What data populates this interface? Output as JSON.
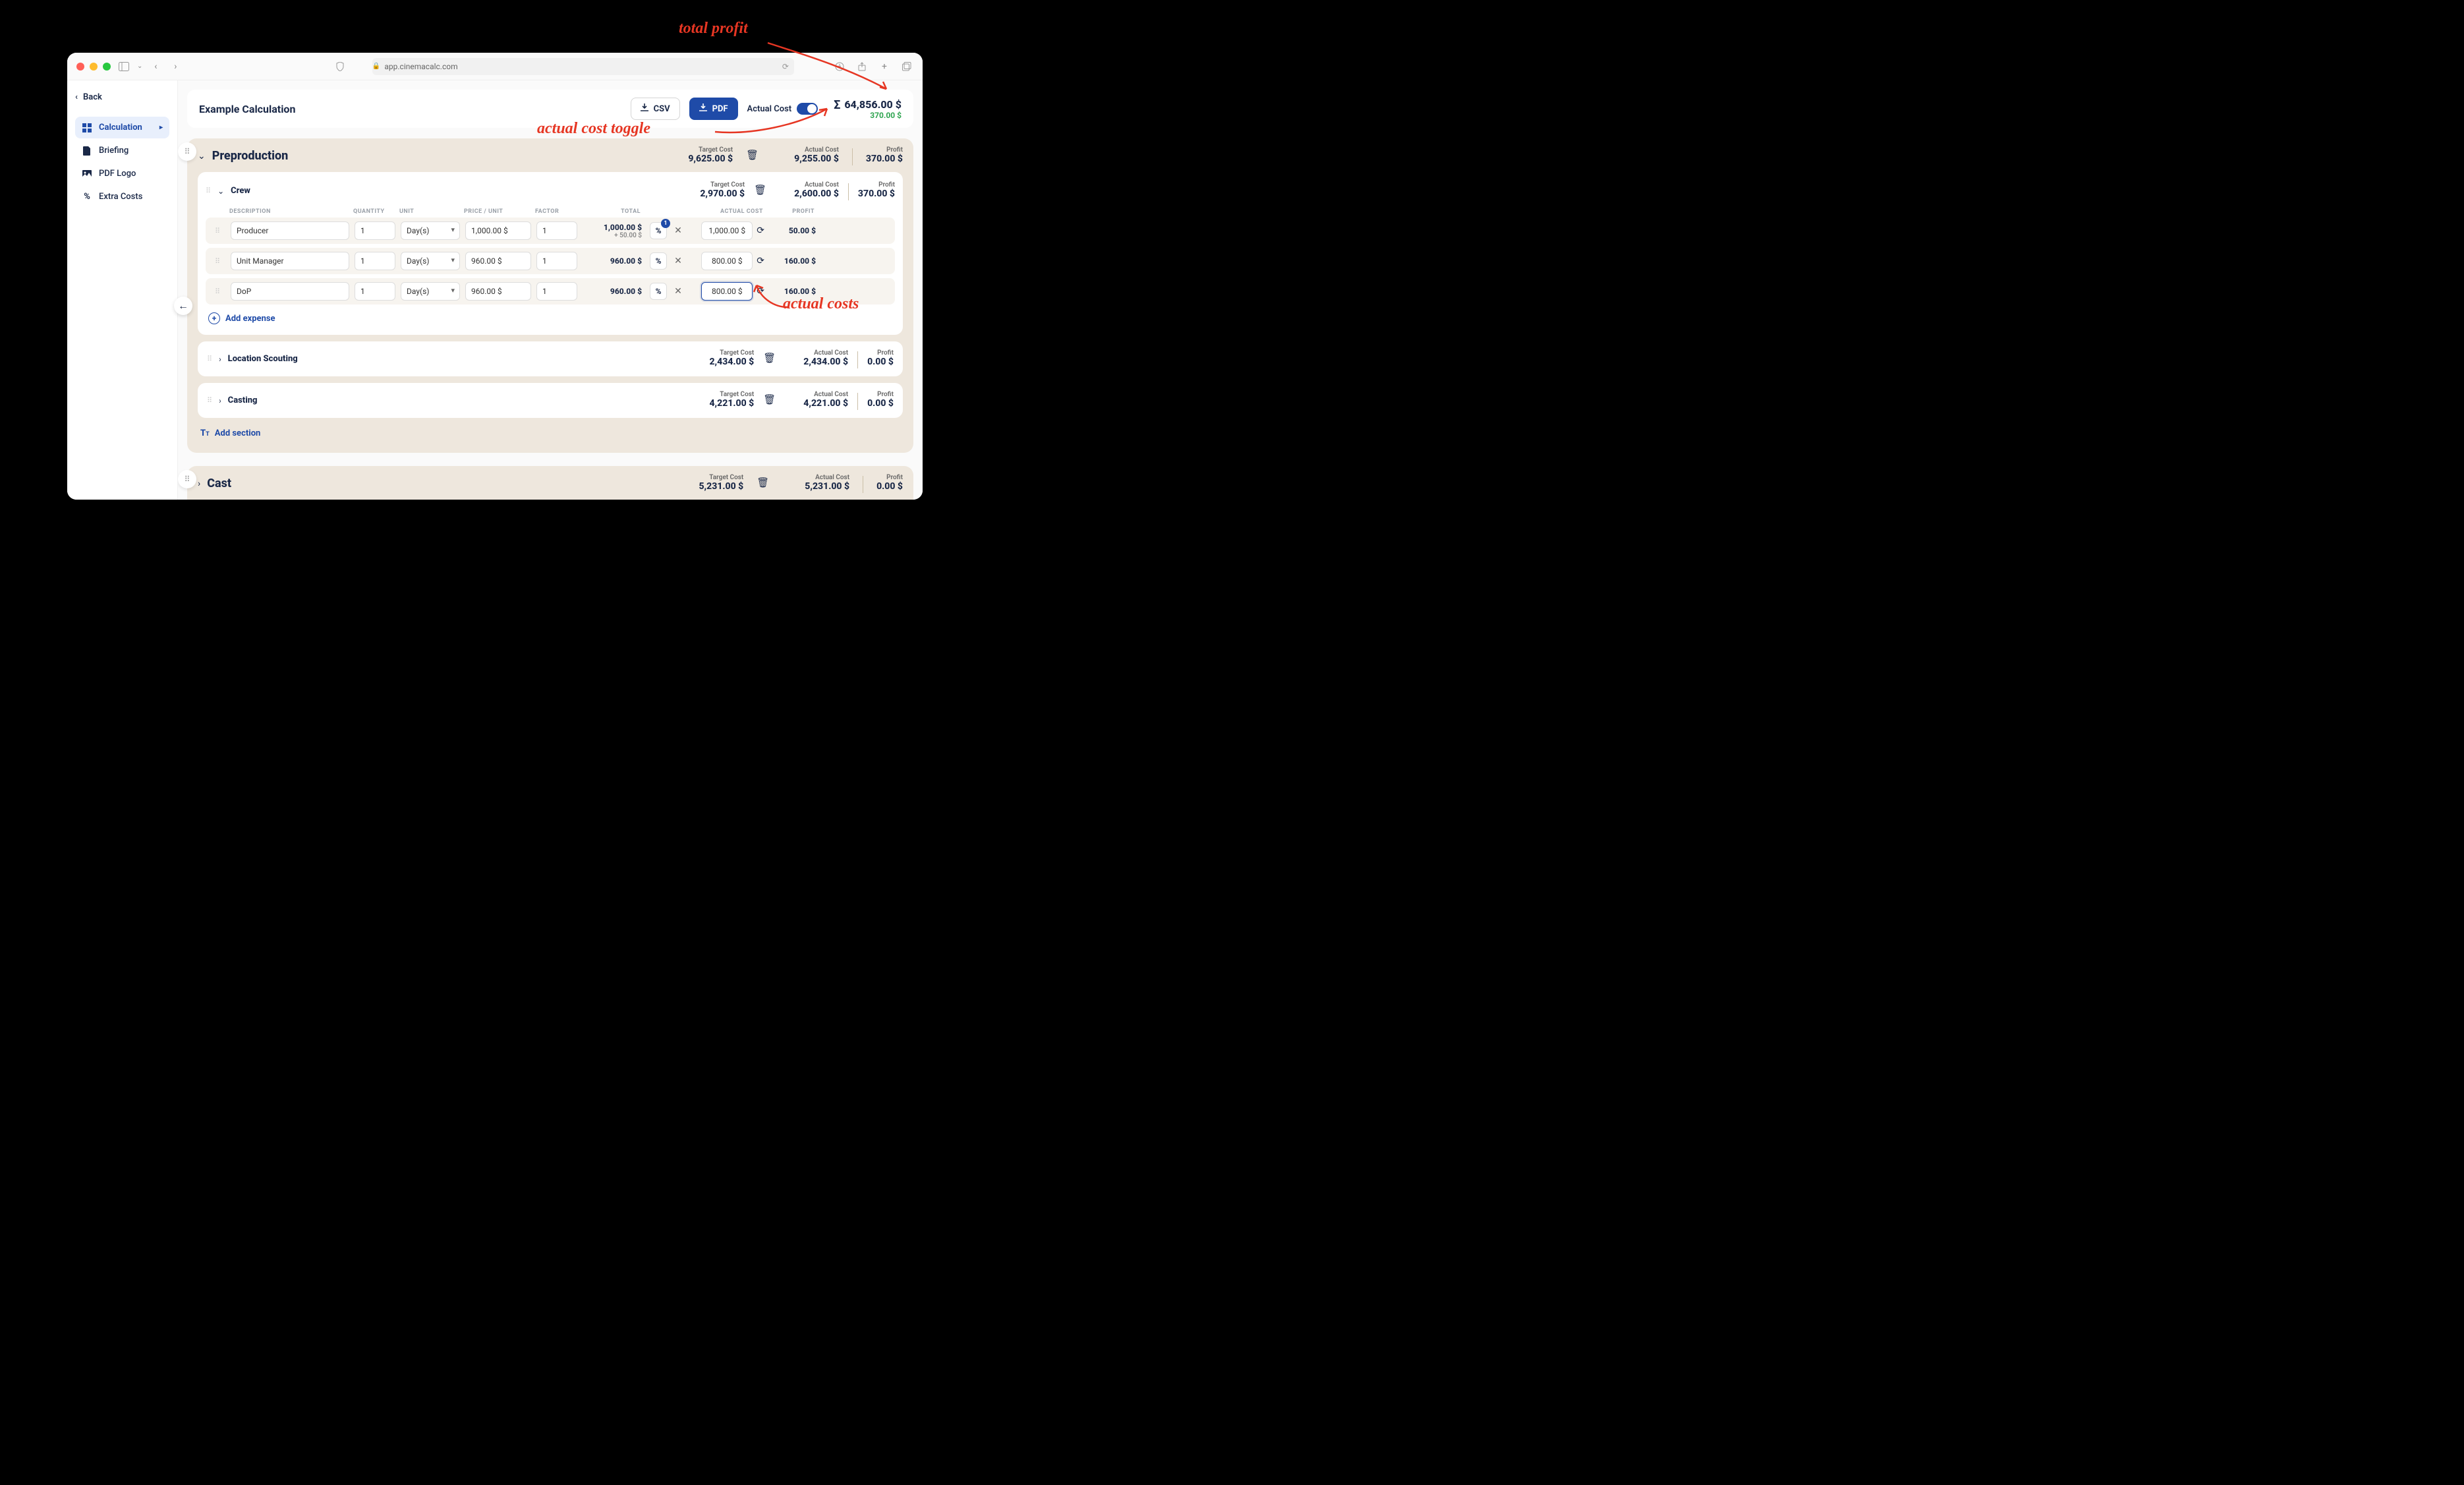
{
  "browser": {
    "url": "app.cinemacalc.com"
  },
  "sidebar": {
    "back": "Back",
    "items": [
      {
        "label": "Calculation",
        "icon": "grid-icon",
        "active": true
      },
      {
        "label": "Briefing",
        "icon": "doc-icon",
        "active": false
      },
      {
        "label": "PDF Logo",
        "icon": "image-icon",
        "active": false
      },
      {
        "label": "Extra Costs",
        "icon": "percent-icon",
        "active": false
      }
    ]
  },
  "topbar": {
    "title": "Example Calculation",
    "csv": "CSV",
    "pdf": "PDF",
    "toggle_label": "Actual Cost",
    "total": "64,856.00 $",
    "profit": "370.00 $"
  },
  "group1": {
    "title": "Preproduction",
    "target_label": "Target Cost",
    "target": "9,625.00 $",
    "actual_label": "Actual Cost",
    "actual": "9,255.00 $",
    "profit_label": "Profit",
    "profit": "370.00 $",
    "crew": {
      "title": "Crew",
      "target_label": "Target Cost",
      "target": "2,970.00 $",
      "actual_label": "Actual Cost",
      "actual": "2,600.00 $",
      "profit_label": "Profit",
      "profit": "370.00 $",
      "cols": {
        "desc": "DESCRIPTION",
        "qty": "QUANTITY",
        "unit": "UNIT",
        "price": "PRICE / UNIT",
        "factor": "FACTOR",
        "total": "TOTAL",
        "actual": "ACTUAL COST",
        "profitc": "PROFIT"
      },
      "rows": [
        {
          "desc": "Producer",
          "qty": "1",
          "unit": "Day(s)",
          "price": "1,000.00 $",
          "factor": "1",
          "total": "1,000.00 $",
          "extra": "+ 50.00 $",
          "badge": "1",
          "actual": "1,000.00 $",
          "profit": "50.00 $"
        },
        {
          "desc": "Unit Manager",
          "qty": "1",
          "unit": "Day(s)",
          "price": "960.00 $",
          "factor": "1",
          "total": "960.00 $",
          "actual": "800.00 $",
          "profit": "160.00 $"
        },
        {
          "desc": "DoP",
          "qty": "1",
          "unit": "Day(s)",
          "price": "960.00 $",
          "factor": "1",
          "total": "960.00 $",
          "actual": "800.00 $",
          "profit": "160.00 $",
          "active": true
        }
      ],
      "add": "Add expense"
    },
    "loc": {
      "title": "Location Scouting",
      "target_label": "Target Cost",
      "target": "2,434.00 $",
      "actual_label": "Actual Cost",
      "actual": "2,434.00 $",
      "profit_label": "Profit",
      "profit": "0.00 $"
    },
    "casting": {
      "title": "Casting",
      "target_label": "Target Cost",
      "target": "4,221.00 $",
      "actual_label": "Actual Cost",
      "actual": "4,221.00 $",
      "profit_label": "Profit",
      "profit": "0.00 $"
    },
    "add_section": "Add section"
  },
  "group2": {
    "title": "Cast",
    "target_label": "Target Cost",
    "target": "5,231.00 $",
    "actual_label": "Actual Cost",
    "actual": "5,231.00 $",
    "profit_label": "Profit",
    "profit": "0.00 $"
  },
  "annotations": {
    "total_profit": "total profit",
    "toggle": "actual cost toggle",
    "actual_costs": "actual costs"
  }
}
